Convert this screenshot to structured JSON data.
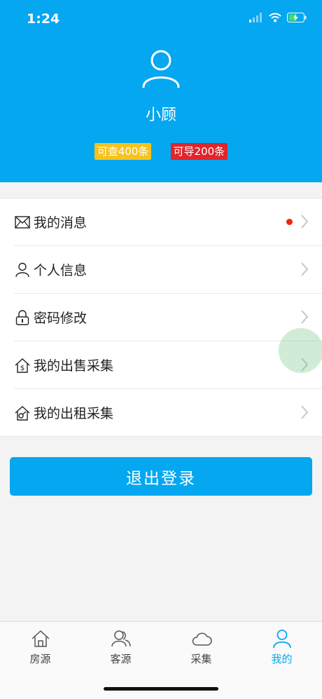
{
  "status_bar": {
    "time": "1:24",
    "icons": [
      "cellular-signal-icon",
      "wifi-icon",
      "battery-charging-icon"
    ]
  },
  "profile": {
    "avatar_icon": "user-avatar-icon",
    "name": "小顾",
    "query_quota": "可查400条",
    "export_quota": "可导200条"
  },
  "menu": {
    "items": [
      {
        "label": "我的消息",
        "icon": "envelope-icon",
        "has_unread_dot": true
      },
      {
        "label": "个人信息",
        "icon": "person-icon"
      },
      {
        "label": "密码修改",
        "icon": "lock-icon"
      },
      {
        "label": "我的出售采集",
        "icon": "house-dollar-icon"
      },
      {
        "label": "我的出租采集",
        "icon": "house-key-icon"
      }
    ]
  },
  "logout_label": "退出登录",
  "tabbar": {
    "tabs": [
      {
        "label": "房源",
        "icon": "home-icon"
      },
      {
        "label": "客源",
        "icon": "users-icon"
      },
      {
        "label": "采集",
        "icon": "cloud-icon"
      },
      {
        "label": "我的",
        "icon": "user-icon",
        "active": true
      }
    ]
  },
  "colors": {
    "primary": "#05a7f0",
    "query_badge": "#f6c31b",
    "export_badge": "#e2242b",
    "unread_dot": "#f5230d"
  }
}
